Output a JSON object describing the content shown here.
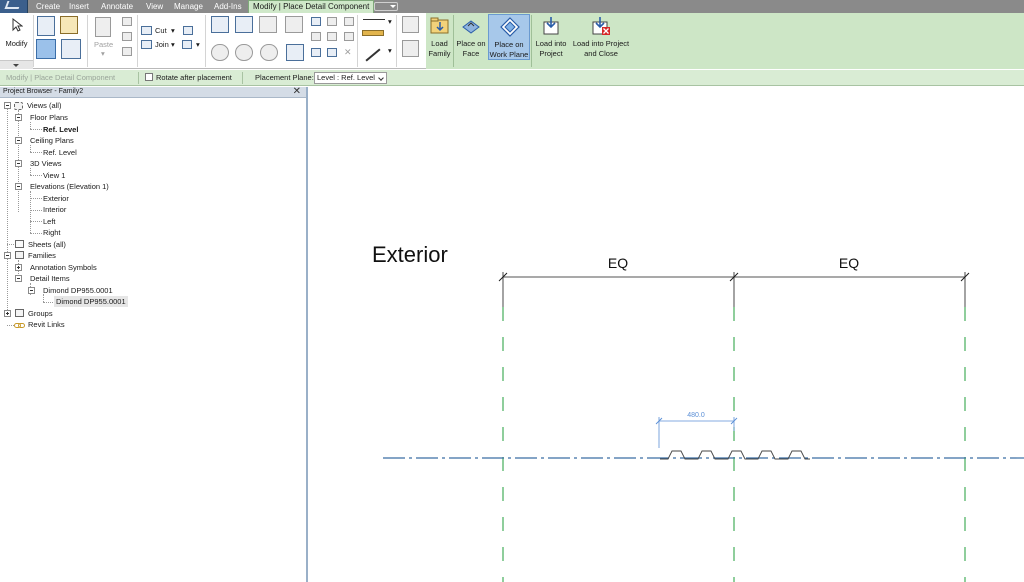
{
  "ribbon": {
    "tabs": [
      "Create",
      "Insert",
      "Annotate",
      "View",
      "Manage",
      "Add-Ins"
    ],
    "active_tab": "Modify | Place Detail Component",
    "modify_label": "Modify",
    "paste_label": "Paste",
    "cut_label": "Cut",
    "join_label": "Join",
    "load_family_label": "Load Family",
    "place_on_face_label": "Place on Face",
    "place_on_work_plane_label": "Place on Work Plane",
    "load_into_project_label": "Load into Project",
    "load_into_project_close_label": "Load into Project and Close"
  },
  "options_bar": {
    "context": "Modify | Place Detail Component",
    "rotate_after_placement": "Rotate after placement",
    "rotate_checked": false,
    "placement_plane_label": "Placement Plane:",
    "placement_plane_value": "Level : Ref. Level"
  },
  "project_browser": {
    "title": "Project Browser - Family2",
    "close_glyph": "✕",
    "views_all": "Views (all)",
    "floor_plans": "Floor Plans",
    "floor_plans_ref_level": "Ref. Level",
    "ceiling_plans": "Ceiling Plans",
    "ceiling_plans_ref_level": "Ref. Level",
    "views_3d": "3D Views",
    "view_1": "View 1",
    "elevations": "Elevations (Elevation 1)",
    "exterior": "Exterior",
    "interior": "Interior",
    "left": "Left",
    "right": "Right",
    "sheets_all": "Sheets (all)",
    "families": "Families",
    "annotation_symbols": "Annotation Symbols",
    "detail_items": "Detail Items",
    "dimond_family": "Dimond DP955.0001",
    "dimond_type": "Dimond DP955.0001",
    "groups": "Groups",
    "revit_links": "Revit Links"
  },
  "canvas": {
    "view_title": "Exterior",
    "eq_left": "EQ",
    "eq_right": "EQ",
    "temp_dimension": "480.0",
    "colors": {
      "ref_plane": "#1f9e3a",
      "level_line": "#3a6ea5",
      "temp_dim": "#5b8fd6",
      "dimension": "#1a1a1a"
    }
  }
}
